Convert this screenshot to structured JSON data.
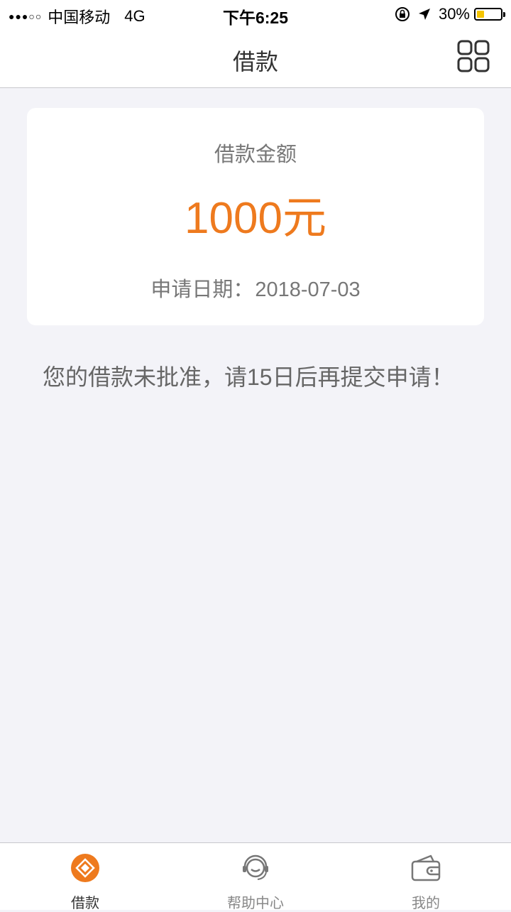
{
  "status_bar": {
    "signal": "●●●○○",
    "carrier": "中国移动",
    "network": "4G",
    "time": "下午6:25",
    "battery_percent": "30%",
    "battery_level": 0.3,
    "battery_color": "#f5c400",
    "icons": [
      "rotation-lock-icon",
      "location-arrow-icon",
      "battery-icon"
    ]
  },
  "nav": {
    "title": "借款",
    "right_icon": "grid-menu-icon"
  },
  "loan_card": {
    "amount_label": "借款金额",
    "amount": "1000元",
    "date_label": "申请日期：",
    "date_value": "2018-07-03"
  },
  "notice": "您的借款未批准，请15日后再提交申请！",
  "tabs": [
    {
      "label": "借款",
      "icon": "loan-diamond-icon",
      "active": true
    },
    {
      "label": "帮助中心",
      "icon": "customer-service-headset-icon",
      "active": false
    },
    {
      "label": "我的",
      "icon": "wallet-icon",
      "active": false
    }
  ],
  "colors": {
    "accent": "#ee7a1e",
    "background": "#f3f3f8",
    "text_secondary": "#777777"
  }
}
